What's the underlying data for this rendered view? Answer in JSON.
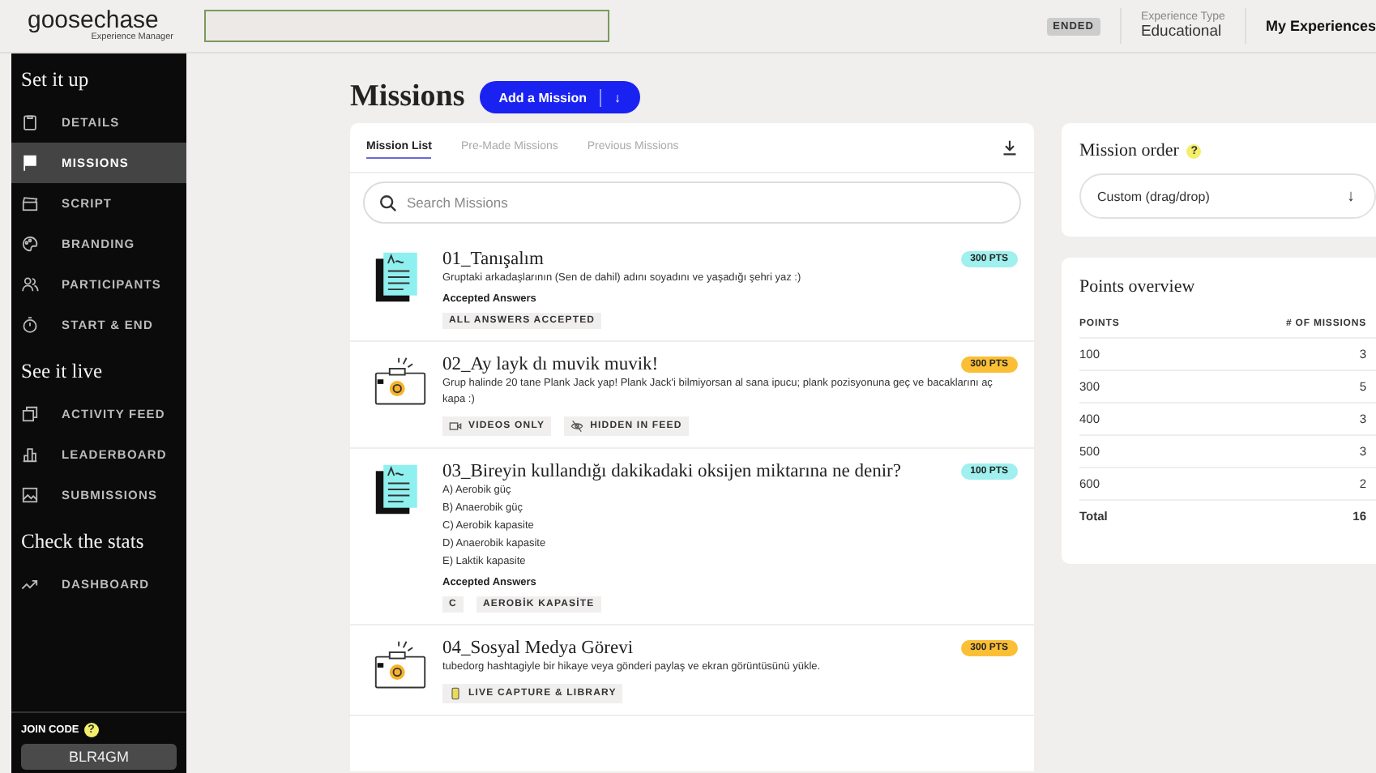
{
  "header": {
    "logo": "goosechase",
    "logo_subtitle": "Experience Manager",
    "status": "ENDED",
    "experience_type_label": "Experience Type",
    "experience_type": "Educational",
    "my_experiences": "My Experiences"
  },
  "sidebar": {
    "sections": [
      {
        "title": "Set it up",
        "items": [
          {
            "kind": "clipboard",
            "label": "DETAILS",
            "selected": false
          },
          {
            "kind": "flag",
            "label": "MISSIONS",
            "selected": true
          },
          {
            "kind": "clapper",
            "label": "SCRIPT",
            "selected": false
          },
          {
            "kind": "palette",
            "label": "BRANDING",
            "selected": false
          },
          {
            "kind": "people",
            "label": "PARTICIPANTS",
            "selected": false
          },
          {
            "kind": "timer",
            "label": "START & END",
            "selected": false
          }
        ]
      },
      {
        "title": "See it live",
        "items": [
          {
            "kind": "feed",
            "label": "ACTIVITY FEED",
            "selected": false
          },
          {
            "kind": "chart",
            "label": "LEADERBOARD",
            "selected": false
          },
          {
            "kind": "image",
            "label": "SUBMISSIONS",
            "selected": false
          }
        ]
      },
      {
        "title": "Check the stats",
        "items": [
          {
            "kind": "trend",
            "label": "DASHBOARD",
            "selected": false
          }
        ]
      }
    ],
    "join_code_label": "JOIN CODE",
    "join_code_help": "?",
    "join_code": "BLR4GM"
  },
  "page": {
    "title": "Missions",
    "add_button": "Add a Mission",
    "add_caret": "↓"
  },
  "missions_card": {
    "tabs": [
      {
        "label": "Mission List",
        "selected": true
      },
      {
        "label": "Pre-Made Missions",
        "selected": false
      },
      {
        "label": "Previous Missions",
        "selected": false
      }
    ],
    "search": {
      "placeholder": "Search Missions"
    },
    "missions": [
      {
        "kind": "text",
        "title": "01_Tanışalım",
        "description": [
          "Gruptaki arkadaşlarının (Sen de dahil) adını soyadını ve yaşadığı şehri yaz :)"
        ],
        "points": "300 PTS",
        "color": "#9ff0ee",
        "answers_label": "Accepted Answers",
        "tags": [
          {
            "kind": "plain",
            "label": "ALL ANSWERS ACCEPTED"
          }
        ]
      },
      {
        "kind": "photo",
        "title": "02_Ay layk dı muvik muvik!",
        "description": [
          "Grup halinde 20 tane Plank Jack yap! Plank Jack'i bilmiyorsan al sana ipucu; plank pozisyonuna geç ve bacaklarını aç kapa :)"
        ],
        "points": "300 PTS",
        "color": "#fbbf36",
        "tags": [
          {
            "kind": "video",
            "label": "VIDEOS ONLY"
          },
          {
            "kind": "hidden",
            "label": "HIDDEN IN FEED"
          }
        ]
      },
      {
        "kind": "text",
        "title": "03_Bireyin kullandığı dakikadaki oksijen miktarına ne denir?",
        "description": [
          "A) Aerobik güç",
          "B) Anaerobik güç",
          "C) Aerobik kapasite",
          "D) Anaerobik kapasite",
          "E) Laktik kapasite"
        ],
        "points": "100 PTS",
        "color": "#9ff0ee",
        "answers_label": "Accepted Answers",
        "tags": [
          {
            "kind": "plain",
            "label": "C"
          },
          {
            "kind": "plain",
            "label": "AEROBİK KAPASİTE"
          }
        ]
      },
      {
        "kind": "photo",
        "title": "04_Sosyal Medya Görevi",
        "description": [
          "tubedorg hashtagiyle bir hikaye veya gönderi paylaş ve ekran görüntüsünü yükle."
        ],
        "points": "300 PTS",
        "color": "#fbbf36",
        "tags": [
          {
            "kind": "capture",
            "label": "LIVE CAPTURE & LIBRARY"
          }
        ]
      }
    ]
  },
  "mission_order": {
    "title": "Mission order",
    "help": "?",
    "value": "Custom (drag/drop)",
    "caret": "↓"
  },
  "points_overview": {
    "title": "Points overview",
    "columns": [
      "POINTS",
      "# OF MISSIONS"
    ],
    "rows": [
      [
        "100",
        "3"
      ],
      [
        "300",
        "5"
      ],
      [
        "400",
        "3"
      ],
      [
        "500",
        "3"
      ],
      [
        "600",
        "2"
      ]
    ],
    "total": [
      "Total",
      "16"
    ]
  }
}
